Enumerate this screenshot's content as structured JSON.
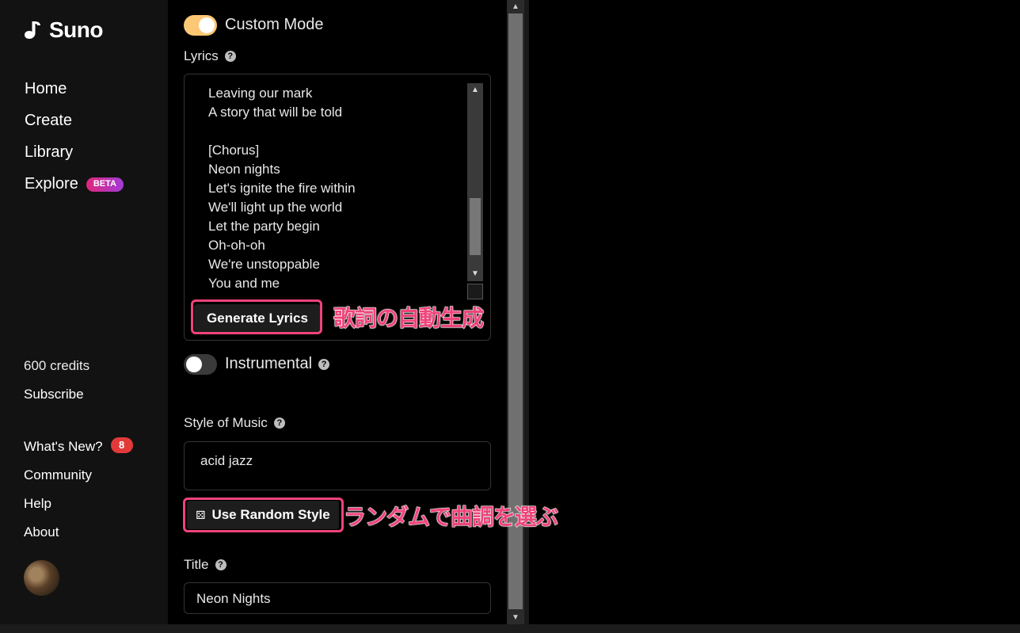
{
  "app": {
    "name": "Suno"
  },
  "sidebar": {
    "nav": [
      {
        "label": "Home"
      },
      {
        "label": "Create"
      },
      {
        "label": "Library"
      },
      {
        "label": "Explore",
        "badge": "BETA"
      }
    ],
    "credits": "600 credits",
    "subscribe": "Subscribe",
    "lower": [
      {
        "label": "What's New?",
        "badge": "8"
      },
      {
        "label": "Community"
      },
      {
        "label": "Help"
      },
      {
        "label": "About"
      }
    ]
  },
  "form": {
    "custom_mode_label": "Custom Mode",
    "custom_mode_on": true,
    "lyrics_label": "Lyrics",
    "lyrics_text": "Leaving our mark\nA story that will be told\n\n[Chorus]\nNeon nights\nLet's ignite the fire within\nWe'll light up the world\nLet the party begin\nOh-oh-oh\nWe're unstoppable\nYou and me",
    "generate_lyrics_button": "Generate Lyrics",
    "instrumental_label": "Instrumental",
    "instrumental_on": false,
    "style_label": "Style of Music",
    "style_value": "acid jazz",
    "random_style_button": "Use Random Style",
    "title_label": "Title",
    "title_value": "Neon Nights"
  },
  "annotations": {
    "generate_lyrics": "歌詞の自動生成",
    "random_style": "ランダムで曲調を選ぶ"
  },
  "colors": {
    "accent_toggle": "#fcc874",
    "highlight": "#f0437a",
    "badge_red": "#e23a3a"
  }
}
